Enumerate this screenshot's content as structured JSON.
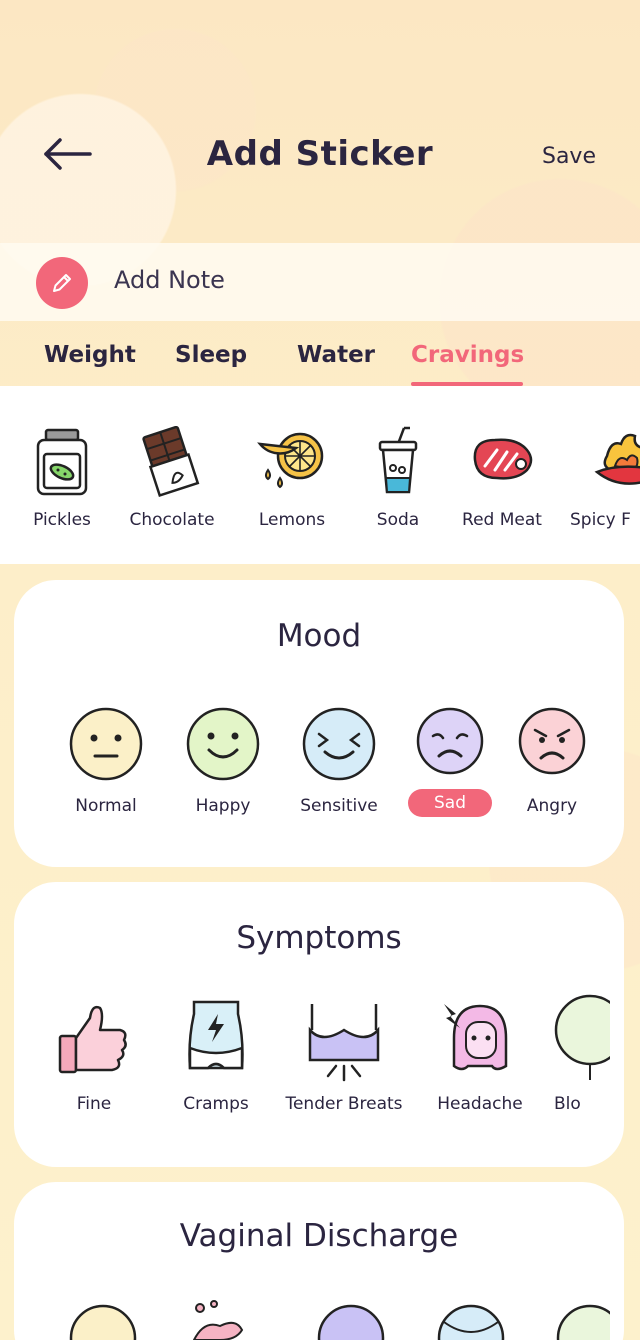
{
  "header": {
    "title": "Add Sticker",
    "save_label": "Save",
    "back_icon": "arrow-left-icon"
  },
  "note": {
    "label": "Add Note",
    "icon": "pencil-icon",
    "accent": "#f2677a"
  },
  "tabs": [
    {
      "label": "Weight"
    },
    {
      "label": "Sleep"
    },
    {
      "label": "Water"
    },
    {
      "label": "Cravings",
      "active": true
    }
  ],
  "cravings": [
    {
      "label": "Pickles",
      "icon": "pickle-jar-icon"
    },
    {
      "label": "Chocolate",
      "icon": "chocolate-bar-icon"
    },
    {
      "label": "Lemons",
      "icon": "lemon-slice-icon"
    },
    {
      "label": "Soda",
      "icon": "soda-cup-icon"
    },
    {
      "label": "Red Meat",
      "icon": "steak-icon"
    },
    {
      "label": "Spicy F",
      "icon": "chili-fire-icon"
    }
  ],
  "mood": {
    "title": "Mood",
    "items": [
      {
        "label": "Normal",
        "icon": "normal-face-icon",
        "color": "#fbf0c8"
      },
      {
        "label": "Happy",
        "icon": "happy-face-icon",
        "color": "#e3f5c8"
      },
      {
        "label": "Sensitive",
        "icon": "sensitive-face-icon",
        "color": "#d6ecf8"
      },
      {
        "label": "Sad",
        "icon": "sad-face-icon",
        "color": "#ddd3f7",
        "selected": true
      },
      {
        "label": "Angry",
        "icon": "angry-face-icon",
        "color": "#fbd2d6"
      }
    ]
  },
  "symptoms": {
    "title": "Symptoms",
    "items": [
      {
        "label": "Fine",
        "icon": "thumbs-up-icon"
      },
      {
        "label": "Cramps",
        "icon": "cramps-icon"
      },
      {
        "label": "Tender Breats",
        "icon": "tender-breasts-icon"
      },
      {
        "label": "Headache",
        "icon": "headache-icon"
      },
      {
        "label": "Blo",
        "icon": "bloating-icon"
      }
    ]
  },
  "vaginal_discharge": {
    "title": "Vaginal Discharge"
  }
}
